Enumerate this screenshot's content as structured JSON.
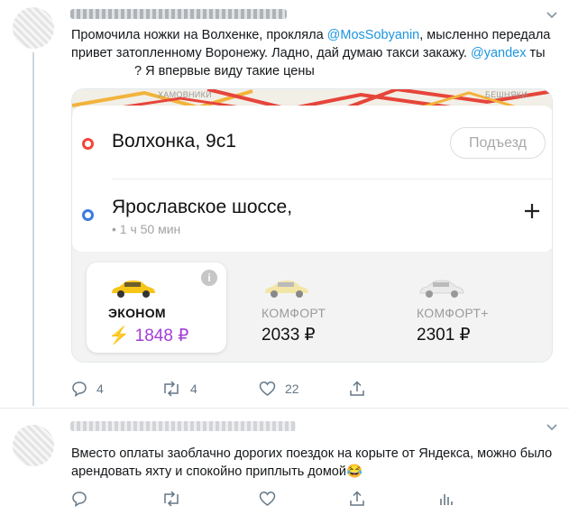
{
  "tweet1": {
    "author_name": "",
    "author_handle": "",
    "text_part1": "Промочила ножки на Волхенке, проклял",
    "text_a": "а ",
    "mention1": "@MosSobyanin",
    "text_part2": ", мысленно передала привет затопленному Воронежу. Ладно, дай думаю такси закажу. ",
    "mention2": "@yandex",
    "text_part3": " ты",
    "text_part4": "? Я впервые виду такие цены",
    "card": {
      "map_labels": [
        "ХАМОВНИКИ",
        "БЕШНЯКИ"
      ],
      "from_address": "Волхонка, 9с1",
      "entrance_button": "Подъезд",
      "to_address": "Ярославское шоссе,",
      "eta": "• 1 ч 50 мин",
      "add_stop_icon": "plus-icon",
      "tariffs": [
        {
          "name": "ЭКОНОМ",
          "price": "1848 ₽",
          "selected": true,
          "car_color": "#f5c518"
        },
        {
          "name": "КОМФОРТ",
          "price": "2033 ₽",
          "selected": false,
          "car_color": "#f3e5a5"
        },
        {
          "name": "КОМФОРТ+",
          "price": "2301 ₽",
          "selected": false,
          "car_color": "#eaeaea"
        }
      ],
      "info_icon": "i",
      "accent_color": "#a43dd9"
    },
    "actions": {
      "reply_count": "4",
      "retweet_count": "4",
      "like_count": "22"
    }
  },
  "tweet2": {
    "author_name": "",
    "text": "Вместо оплаты заоблачно дорогих поездок на корыте от Яндекса, можно было арендовать яхту и спокойно приплыть домой😂"
  },
  "colors": {
    "mention": "#1b95e0",
    "action_gray": "#657786"
  }
}
